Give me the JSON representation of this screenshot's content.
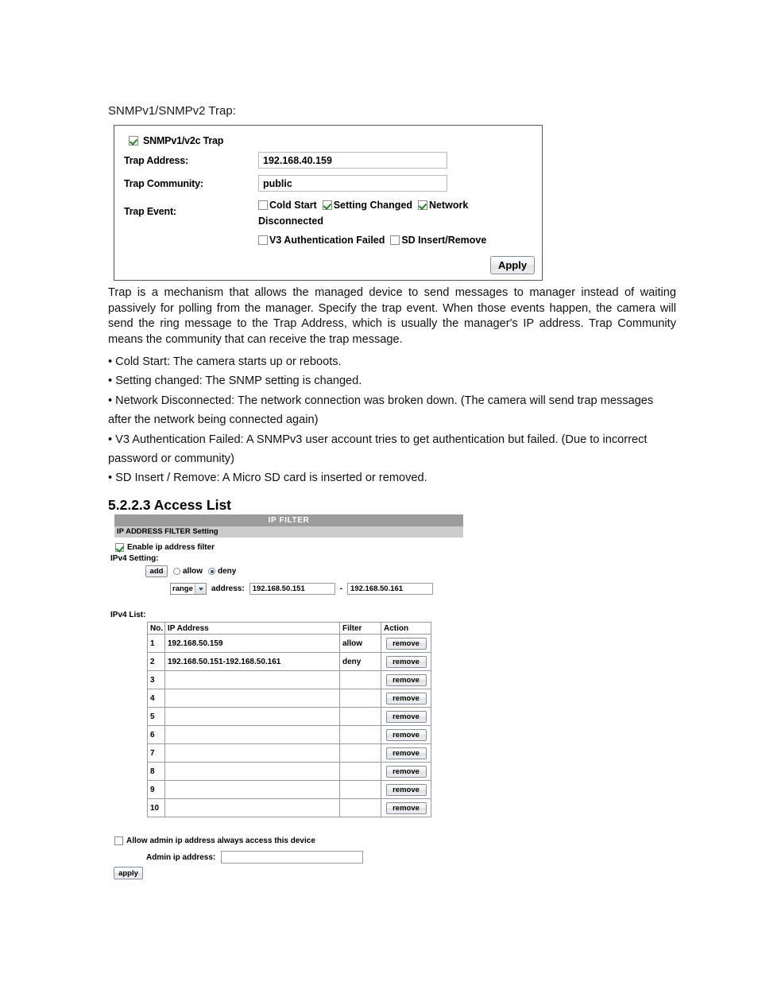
{
  "page": {
    "intro_label": "SNMPv1/SNMPv2 Trap:"
  },
  "snmp_panel": {
    "enable_checkbox_label": "SNMPv1/v2c Trap",
    "enable_checked": true,
    "trap_address_label": "Trap Address:",
    "trap_address_value": "192.168.40.159",
    "trap_community_label": "Trap Community:",
    "trap_community_value": "public",
    "trap_event_label": "Trap Event:",
    "events": [
      {
        "label": "Cold Start",
        "checked": false
      },
      {
        "label": "Setting Changed",
        "checked": true
      },
      {
        "label": "Network Disconnected",
        "checked": true
      },
      {
        "label": "V3 Authentication Failed",
        "checked": false
      },
      {
        "label": "SD Insert/Remove",
        "checked": false
      }
    ],
    "apply_label": "Apply"
  },
  "description": {
    "paragraph": "Trap is a mechanism that allows the managed device to send messages to manager instead of waiting passively for polling from the manager. Specify the trap event. When those events happen, the camera will send the ring message to the Trap Address, which is usually the manager's IP address. Trap Community means the community that can receive the trap message.",
    "bullets": [
      "•  Cold Start: The camera starts up or reboots.",
      "•  Setting changed: The SNMP setting is changed.",
      "• Network Disconnected: The network connection was broken down. (The camera will send trap messages after the network being connected again)",
      "• V3 Authentication Failed: A SNMPv3 user account tries to get authentication but failed. (Due to incorrect password or community)",
      "•  SD Insert / Remove: A Micro SD card is inserted or removed."
    ]
  },
  "section": {
    "heading": "5.2.2.3 Access List"
  },
  "ip_filter": {
    "title_bar": "IP FILTER",
    "subtitle_bar": "IP ADDRESS FILTER Setting",
    "enable_label": "Enable ip address filter",
    "enable_checked": true,
    "ipv4_setting_label": "IPv4 Setting:",
    "add_button_label": "add",
    "allow_label": "allow",
    "deny_label": "deny",
    "selected_filter": "deny",
    "range_select_value": "range",
    "address_label": "address:",
    "address_from": "192.168.50.151",
    "address_separator": "-",
    "address_to": "192.168.50.161",
    "list_label": "IPv4 List:",
    "columns": [
      "No.",
      "IP Address",
      "Filter",
      "Action"
    ],
    "remove_label": "remove",
    "rows": [
      {
        "no": "1",
        "ip": "192.168.50.159",
        "filter": "allow"
      },
      {
        "no": "2",
        "ip": "192.168.50.151-192.168.50.161",
        "filter": "deny"
      },
      {
        "no": "3",
        "ip": "",
        "filter": ""
      },
      {
        "no": "4",
        "ip": "",
        "filter": ""
      },
      {
        "no": "5",
        "ip": "",
        "filter": ""
      },
      {
        "no": "6",
        "ip": "",
        "filter": ""
      },
      {
        "no": "7",
        "ip": "",
        "filter": ""
      },
      {
        "no": "8",
        "ip": "",
        "filter": ""
      },
      {
        "no": "9",
        "ip": "",
        "filter": ""
      },
      {
        "no": "10",
        "ip": "",
        "filter": ""
      }
    ],
    "admin_allow_label": "Allow admin ip address always access this device",
    "admin_allow_checked": false,
    "admin_address_label": "Admin ip address:",
    "admin_address_value": "",
    "apply_label": "apply"
  },
  "colors": {
    "title_bar_bg": "#9c9c9c",
    "subtitle_bar_bg": "#cccccc",
    "check_green": "#128a12",
    "radio_blue": "#2255aa"
  }
}
